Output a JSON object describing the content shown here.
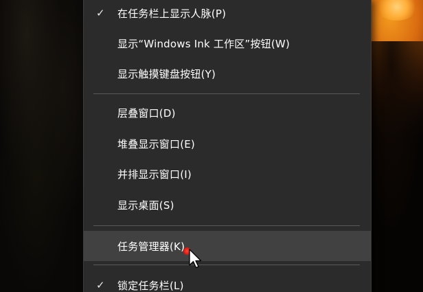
{
  "context_menu": {
    "items": [
      {
        "label": "在任务栏上显示人脉(P)",
        "checked": true
      },
      {
        "label": "显示“Windows Ink 工作区”按钮(W)",
        "checked": false
      },
      {
        "label": "显示触摸键盘按钮(Y)",
        "checked": false
      },
      {
        "label": "层叠窗口(D)",
        "checked": false
      },
      {
        "label": "堆叠显示窗口(E)",
        "checked": false
      },
      {
        "label": "并排显示窗口(I)",
        "checked": false
      },
      {
        "label": "显示桌面(S)",
        "checked": false
      },
      {
        "label": "任务管理器(K)",
        "checked": false,
        "hovered": true
      },
      {
        "label": "锁定任务栏(L)",
        "checked": true
      }
    ],
    "check_glyph": "✓"
  },
  "colors": {
    "menu_background": "#2b2b2b",
    "hover_background": "#414141",
    "separator": "#5a5a5a",
    "text": "#ffffff",
    "click_indicator": "#e21a12"
  },
  "icons": {
    "cursor": "mouse-pointer-icon",
    "check": "checkmark-icon"
  }
}
